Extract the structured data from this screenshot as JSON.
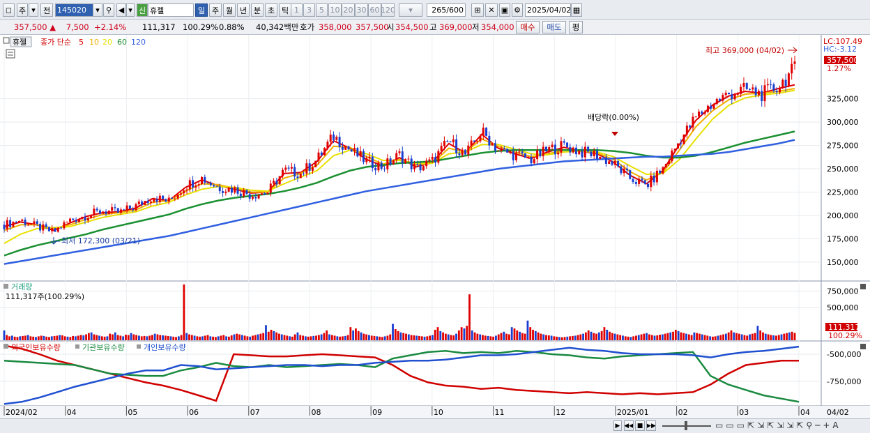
{
  "toolbar": {
    "market": "주",
    "prev_label": "전",
    "code": "145020",
    "new_badge": "신",
    "stock_name": "휴젤",
    "periods": [
      "일",
      "주",
      "월",
      "년",
      "분",
      "초",
      "틱"
    ],
    "active_period": "일",
    "intervals": [
      "1",
      "3",
      "5",
      "10",
      "20",
      "30",
      "60",
      "120"
    ],
    "count": "265",
    "count_max": "/600",
    "date": "2025/04/02"
  },
  "quote": {
    "price": "357,500",
    "arrow": "▲",
    "change": "7,500",
    "change_pct": "+2.14%",
    "volume": "111,317",
    "vol_ratio": "100.29%",
    "turnover_pct": "0.88%",
    "amount": "40,342백만",
    "bid_label": "호가",
    "ask": "358,000",
    "bid": "357,500",
    "open_label": "시",
    "open": "354,500",
    "high_label": "고",
    "high": "369,000",
    "low_label": "저",
    "low": "354,000",
    "buy_label": "매수",
    "sell_label": "매도",
    "avg_label": "평"
  },
  "price_panel": {
    "title": "휴젤",
    "ma_label": "종가 단순",
    "ma_periods": [
      {
        "p": "5",
        "color": "#e00000"
      },
      {
        "p": "10",
        "color": "#f0b000"
      },
      {
        "p": "20",
        "color": "#e8e000"
      },
      {
        "p": "60",
        "color": "#1a9030"
      },
      {
        "p": "120",
        "color": "#3060e0"
      }
    ],
    "lc": "LC:107.49",
    "hc": "HC:-3.12",
    "last_price": "357,500",
    "last_pct": "1.27%",
    "high_note": "최고 369,000 (04/02)",
    "low_note": "최저 172,300 (03/21)",
    "dividend_note": "배당락(0.00%)"
  },
  "volume_panel": {
    "title": "거래량",
    "current": "111,317주(100.29%)",
    "last": "111,317",
    "last_pct": "100.29%"
  },
  "holdings_panel": {
    "series": [
      {
        "name": "외국인보유수량",
        "color": "#d00000"
      },
      {
        "name": "기관보유수량",
        "color": "#1a8a40"
      },
      {
        "name": "개인보유수량",
        "color": "#2050d0"
      }
    ]
  },
  "x_axis": {
    "ticks": [
      "2024/02",
      "04",
      "05",
      "06",
      "07",
      "08",
      "09",
      "10",
      "11",
      "12",
      "2025/01",
      "02",
      "03",
      "04"
    ],
    "last_date": "04/02"
  },
  "chart_data": [
    {
      "type": "line",
      "title": "휴젤",
      "y_ticks": [
        150000,
        175000,
        200000,
        225000,
        250000,
        275000,
        300000,
        325000
      ],
      "y_tick_labels": [
        "150,000",
        "175,000",
        "200,000",
        "225,000",
        "250,000",
        "275,000",
        "300,000",
        "325,000"
      ],
      "ylim": [
        132000,
        392000
      ],
      "x_month_labels": [
        "2024/02",
        "04",
        "05",
        "06",
        "07",
        "08",
        "09",
        "10",
        "11",
        "12",
        "2025/01",
        "02",
        "03",
        "04"
      ],
      "close_trend": [
        190000,
        195000,
        188000,
        182000,
        195000,
        200000,
        205000,
        203000,
        210000,
        220000,
        215000,
        232000,
        240000,
        230000,
        228000,
        222000,
        225000,
        248000,
        245000,
        260000,
        285000,
        270000,
        258000,
        252000,
        265000,
        250000,
        258000,
        280000,
        265000,
        290000,
        270000,
        265000,
        260000,
        270000,
        275000,
        268000,
        265000,
        255000,
        240000,
        232000,
        250000,
        280000,
        305000,
        320000,
        330000,
        335000,
        330000,
        338000,
        357500
      ],
      "series": [
        {
          "name": "5",
          "values": [
            188000,
            193000,
            190000,
            184000,
            192000,
            199000,
            203000,
            204000,
            208000,
            218000,
            216000,
            230000,
            238000,
            232000,
            228000,
            224000,
            225000,
            245000,
            246000,
            258000,
            280000,
            272000,
            260000,
            253000,
            262000,
            252000,
            257000,
            277000,
            267000,
            287000,
            272000,
            266000,
            261000,
            268000,
            273000,
            269000,
            266000,
            257000,
            243000,
            234000,
            248000,
            276000,
            302000,
            318000,
            328000,
            333000,
            331000,
            336000,
            340000
          ]
        },
        {
          "name": "10",
          "values": [
            184000,
            190000,
            190000,
            186000,
            190000,
            196000,
            201000,
            203000,
            206000,
            214000,
            216000,
            226000,
            234000,
            233000,
            229000,
            225000,
            225000,
            240000,
            245000,
            254000,
            274000,
            273000,
            263000,
            255000,
            260000,
            254000,
            256000,
            272000,
            268000,
            282000,
            274000,
            268000,
            263000,
            266000,
            270000,
            269000,
            267000,
            260000,
            247000,
            238000,
            246000,
            270000,
            295000,
            312000,
            324000,
            330000,
            331000,
            333000,
            336000
          ]
        },
        {
          "name": "20",
          "values": [
            170000,
            180000,
            186000,
            187000,
            188000,
            193000,
            198000,
            201000,
            204000,
            210000,
            214000,
            222000,
            228000,
            231000,
            230000,
            227000,
            226000,
            234000,
            241000,
            248000,
            264000,
            270000,
            266000,
            259000,
            259000,
            256000,
            256000,
            266000,
            268000,
            276000,
            276000,
            271000,
            266000,
            265000,
            268000,
            269000,
            268000,
            263000,
            253000,
            244000,
            245000,
            260000,
            282000,
            303000,
            318000,
            326000,
            329000,
            331000,
            334000
          ]
        },
        {
          "name": "60",
          "values": [
            157000,
            163000,
            168000,
            172000,
            176000,
            180000,
            185000,
            189000,
            193000,
            197000,
            201000,
            207000,
            212000,
            216000,
            219000,
            221000,
            223000,
            226000,
            230000,
            235000,
            242000,
            248000,
            252000,
            254000,
            256000,
            257000,
            258000,
            261000,
            264000,
            267000,
            269000,
            270000,
            270000,
            270000,
            270000,
            270000,
            270000,
            269000,
            267000,
            264000,
            262000,
            262000,
            264000,
            268000,
            273000,
            278000,
            282000,
            286000,
            290000
          ]
        },
        {
          "name": "120",
          "values": [
            148000,
            151000,
            154000,
            157000,
            160000,
            163000,
            166000,
            169000,
            172000,
            175000,
            178000,
            182000,
            186000,
            190000,
            194000,
            198000,
            202000,
            206000,
            210000,
            214000,
            218000,
            222000,
            226000,
            229000,
            232000,
            235000,
            238000,
            241000,
            244000,
            247000,
            250000,
            252000,
            254000,
            256000,
            258000,
            259000,
            260000,
            261000,
            262000,
            263000,
            263000,
            264000,
            265000,
            266000,
            268000,
            271000,
            274000,
            277000,
            281000
          ]
        }
      ]
    },
    {
      "type": "bar",
      "title": "거래량",
      "y_ticks": [
        500000,
        750000
      ],
      "y_tick_labels": [
        "500,000",
        "750,000"
      ],
      "ylim": [
        0,
        850000
      ],
      "values": [
        150000,
        80000,
        60000,
        70000,
        55000,
        50000,
        60000,
        65000,
        70000,
        80000,
        60000,
        55000,
        50000,
        60000,
        70000,
        65000,
        55000,
        50000,
        60000,
        65000,
        70000,
        80000,
        75000,
        60000,
        55000,
        50000,
        65000,
        60000,
        70000,
        80000,
        75000,
        90000,
        110000,
        120000,
        90000,
        80000,
        70000,
        60000,
        55000,
        60000,
        100000,
        90000,
        120000,
        80000,
        70000,
        60000,
        85000,
        80000,
        110000,
        90000,
        80000,
        70000,
        60000,
        65000,
        60000,
        70000,
        80000,
        100000,
        90000,
        80000,
        75000,
        70000,
        65000,
        60000,
        55000,
        50000,
        60000,
        80000,
        850000,
        110000,
        90000,
        80000,
        70000,
        60000,
        55000,
        60000,
        70000,
        80000,
        60000,
        55000,
        50000,
        60000,
        70000,
        80000,
        60000,
        55000,
        75000,
        90000,
        100000,
        90000,
        80000,
        70000,
        60000,
        55000,
        70000,
        80000,
        90000,
        100000,
        110000,
        230000,
        130000,
        160000,
        140000,
        120000,
        100000,
        90000,
        80000,
        70000,
        60000,
        55000,
        90000,
        120000,
        80000,
        70000,
        60000,
        55000,
        60000,
        65000,
        70000,
        80000,
        90000,
        110000,
        150000,
        90000,
        80000,
        70000,
        60000,
        55000,
        60000,
        65000,
        80000,
        200000,
        150000,
        180000,
        140000,
        120000,
        100000,
        90000,
        80000,
        70000,
        65000,
        60000,
        55000,
        50000,
        60000,
        70000,
        90000,
        250000,
        170000,
        140000,
        120000,
        110000,
        100000,
        90000,
        80000,
        75000,
        70000,
        65000,
        60000,
        55000,
        60000,
        70000,
        80000,
        160000,
        200000,
        140000,
        120000,
        100000,
        90000,
        80000,
        75000,
        100000,
        150000,
        200000,
        180000,
        220000,
        700000,
        150000,
        120000,
        100000,
        90000,
        80000,
        70000,
        65000,
        60000,
        55000,
        70000,
        90000,
        110000,
        130000,
        100000,
        90000,
        200000,
        180000,
        150000,
        130000,
        110000,
        100000,
        300000,
        200000,
        160000,
        140000,
        120000,
        100000,
        90000,
        80000,
        75000,
        70000,
        60000,
        55000,
        50000,
        45000,
        50000,
        55000,
        60000,
        65000,
        70000,
        80000,
        90000,
        100000,
        120000,
        150000,
        130000,
        110000,
        100000,
        120000,
        140000,
        200000,
        160000,
        130000,
        110000,
        100000,
        90000,
        80000,
        70000,
        60000,
        55000,
        50000,
        60000,
        70000,
        80000,
        90000,
        100000,
        110000,
        90000,
        80000,
        70000,
        75000,
        85000,
        90000,
        100000,
        110000,
        120000,
        130000,
        160000,
        140000,
        120000,
        110000,
        100000,
        90000,
        80000,
        120000,
        110000,
        100000,
        90000,
        80000,
        70000,
        60000,
        55000,
        60000,
        70000,
        80000,
        90000,
        100000,
        120000,
        150000,
        120000,
        110000,
        100000,
        90000,
        80000,
        70000,
        90000,
        100000,
        110000,
        220000,
        150000,
        120000,
        100000,
        90000,
        80000,
        75000,
        70000,
        80000,
        90000,
        100000,
        110000,
        120000,
        130000,
        111317
      ]
    },
    {
      "type": "line",
      "title": "보유수량",
      "y_ticks": [
        -500000,
        -750000
      ],
      "y_tick_labels": [
        "-500,000",
        "-750,000"
      ],
      "ylim": [
        -970000,
        -410000
      ],
      "series": [
        {
          "name": "외국인보유수량",
          "values": [
            -420000,
            -450000,
            -500000,
            -560000,
            -600000,
            -640000,
            -680000,
            -720000,
            -760000,
            -790000,
            -830000,
            -880000,
            -930000,
            -500000,
            -510000,
            -520000,
            -520000,
            -510000,
            -500000,
            -510000,
            -520000,
            -530000,
            -600000,
            -700000,
            -760000,
            -790000,
            -800000,
            -820000,
            -810000,
            -830000,
            -840000,
            -850000,
            -860000,
            -850000,
            -860000,
            -870000,
            -860000,
            -870000,
            -860000,
            -850000,
            -780000,
            -680000,
            -600000,
            -580000,
            -560000,
            -560000
          ]
        },
        {
          "name": "기관보유수량",
          "values": [
            -560000,
            -570000,
            -580000,
            -590000,
            -600000,
            -640000,
            -680000,
            -690000,
            -700000,
            -700000,
            -650000,
            -620000,
            -580000,
            -610000,
            -620000,
            -600000,
            -620000,
            -610000,
            -600000,
            -590000,
            -600000,
            -620000,
            -540000,
            -510000,
            -480000,
            -470000,
            -490000,
            -480000,
            -490000,
            -470000,
            -480000,
            -500000,
            -510000,
            -530000,
            -540000,
            -520000,
            -510000,
            -500000,
            -490000,
            -480000,
            -700000,
            -780000,
            -830000,
            -880000,
            -910000,
            -940000
          ]
        },
        {
          "name": "개인보유수량",
          "values": [
            -960000,
            -940000,
            -900000,
            -850000,
            -800000,
            -760000,
            -720000,
            -680000,
            -650000,
            -650000,
            -600000,
            -610000,
            -640000,
            -630000,
            -620000,
            -610000,
            -600000,
            -600000,
            -610000,
            -600000,
            -600000,
            -580000,
            -570000,
            -560000,
            -560000,
            -550000,
            -530000,
            -510000,
            -510000,
            -500000,
            -480000,
            -460000,
            -440000,
            -460000,
            -470000,
            -490000,
            -500000,
            -500000,
            -500000,
            -510000,
            -530000,
            -500000,
            -480000,
            -470000,
            -450000,
            -430000
          ]
        }
      ]
    }
  ]
}
